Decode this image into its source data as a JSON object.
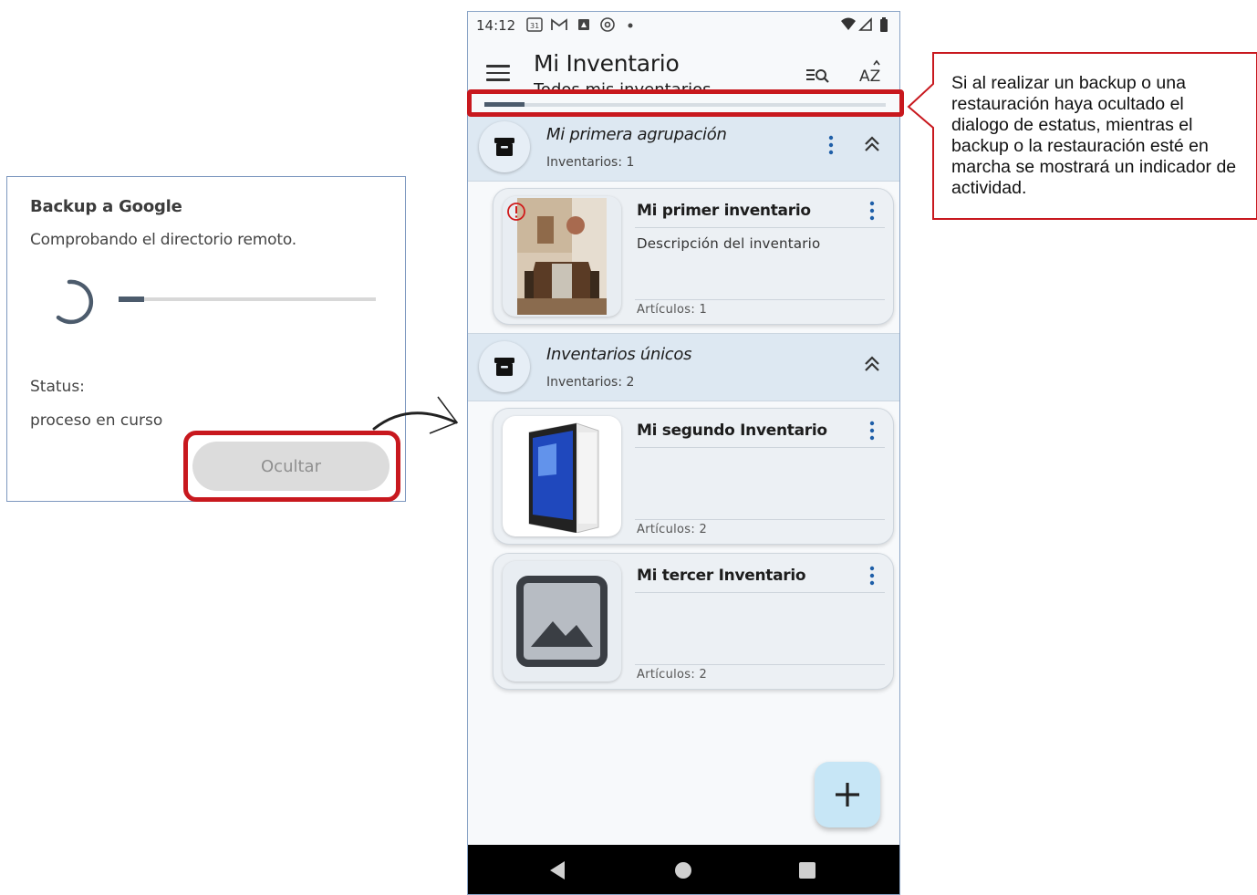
{
  "dialog": {
    "title": "Backup a Google",
    "message": "Comprobando el directorio remoto.",
    "progress": 0.1,
    "status_label": "Status:",
    "status_value": "proceso en curso",
    "hide_button": "Ocultar"
  },
  "phone": {
    "status_bar": {
      "time": "14:12",
      "icons": [
        "calendar-icon",
        "gmail-icon",
        "notification-icon",
        "at-icon",
        "dot-icon",
        "wifi-icon",
        "signal-icon",
        "battery-icon"
      ]
    },
    "app_bar": {
      "title": "Mi Inventario",
      "subtitle": "Todos mis inventarios",
      "actions": [
        "filter-search-icon",
        "sort-az-icon"
      ],
      "activity_progress": 0.1
    },
    "groups": [
      {
        "title": "Mi primera agrupación",
        "count": "Inventarios: 1",
        "has_menu": true,
        "items": [
          {
            "title": "Mi primer inventario",
            "description": "Descripción del inventario",
            "count": "Artículos: 1",
            "image": "dining-room",
            "warning": true
          }
        ]
      },
      {
        "title": "Inventarios únicos",
        "count": "Inventarios: 2",
        "has_menu": false,
        "items": [
          {
            "title": "Mi segundo Inventario",
            "description": "",
            "count": "Artículos: 2",
            "image": "pc-tower"
          },
          {
            "title": "Mi tercer Inventario",
            "description": "",
            "count": "Artículos: 2",
            "image": "placeholder"
          }
        ]
      }
    ],
    "fab": "add-icon",
    "nav": [
      "back-icon",
      "home-icon",
      "recents-icon"
    ]
  },
  "callout": {
    "text": "Si al realizar un backup o una\nrestauración haya ocultado el\ndialogo de estatus, mientras el\nbackup o la restauración esté en\nmarcha se mostrará un indicador de\nactividad."
  },
  "colors": {
    "highlight": "#c8181e",
    "header_bg": "#dde8f2",
    "card_bg": "#ecf0f4",
    "fab_bg": "#c7e6f6",
    "menu_dots": "#1f5fa8"
  }
}
